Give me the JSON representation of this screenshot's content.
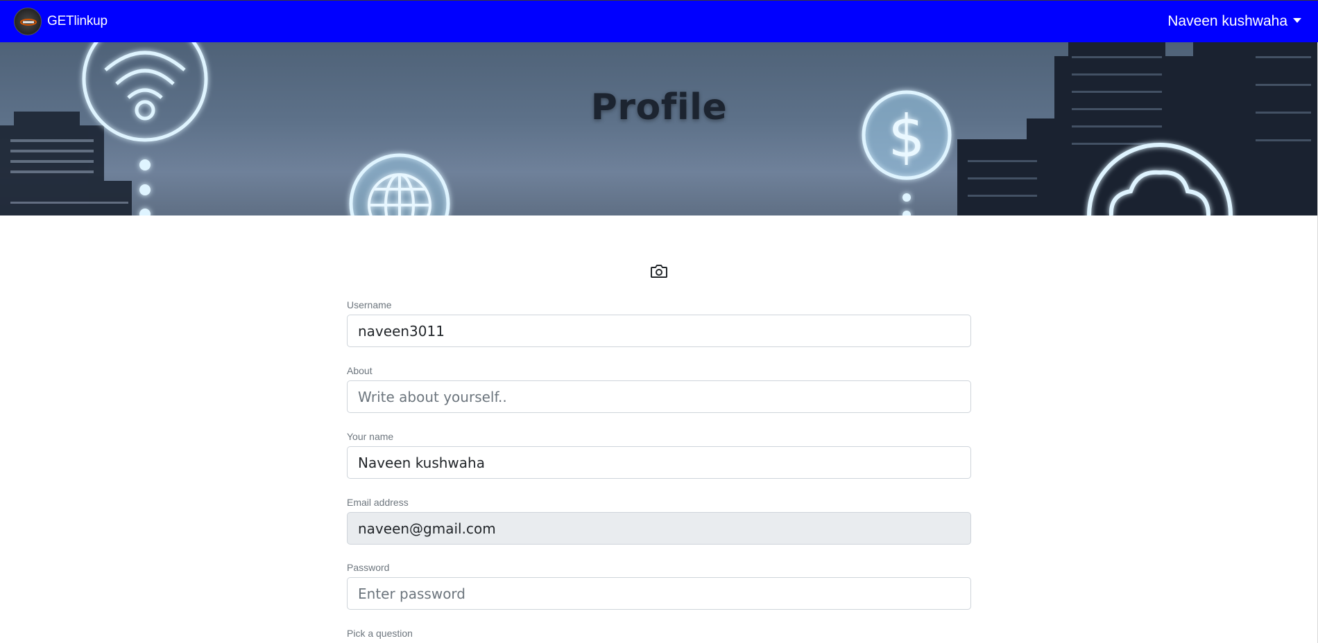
{
  "navbar": {
    "brand_name": "GETlinkup",
    "user_name": "Naveen kushwaha",
    "bg_color": "#0000ff"
  },
  "banner": {
    "title": "Profile"
  },
  "profile_form": {
    "camera_icon": "camera-icon",
    "fields": {
      "username": {
        "label": "Username",
        "value": "naveen3011"
      },
      "about": {
        "label": "About",
        "placeholder": "Write about yourself.."
      },
      "name": {
        "label": "Your name",
        "value": "Naveen kushwaha"
      },
      "email": {
        "label": "Email address",
        "value": "naveen@gmail.com"
      },
      "password": {
        "label": "Password",
        "placeholder": "Enter password"
      },
      "question": {
        "label": "Pick a question"
      }
    }
  }
}
